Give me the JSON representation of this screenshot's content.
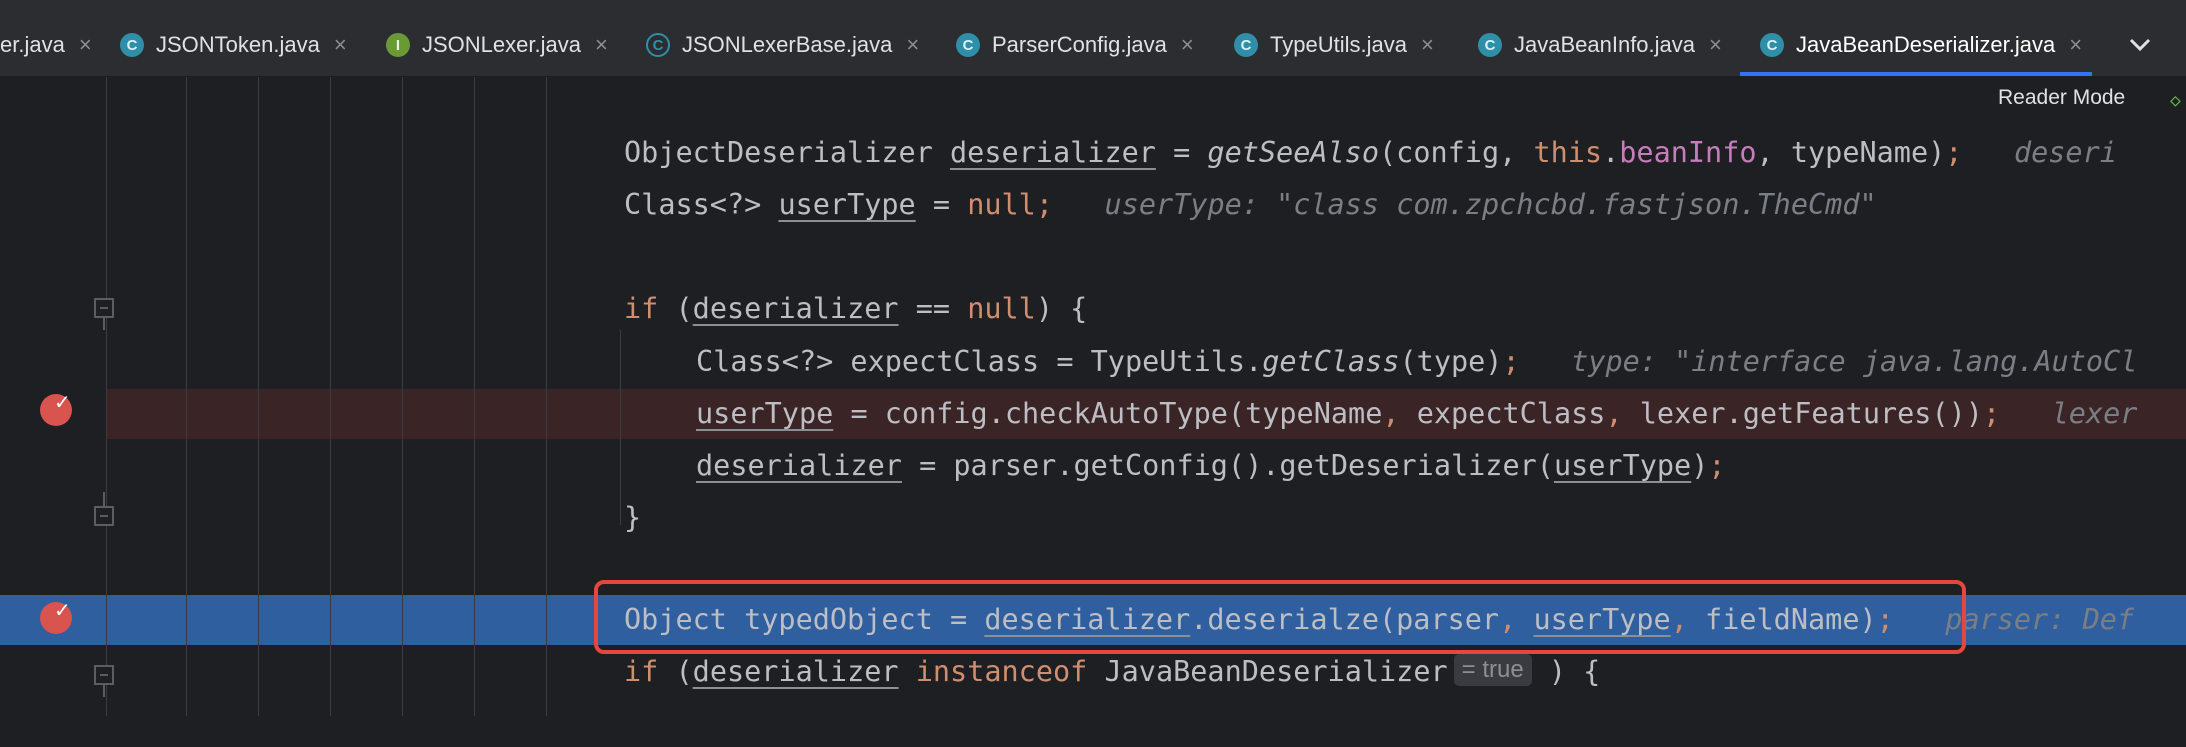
{
  "tabs": [
    {
      "label": "er.java",
      "icon": "class-icon",
      "kind": ""
    },
    {
      "label": "JSONToken.java",
      "icon": "class-icon",
      "kind": "c"
    },
    {
      "label": "JSONLexer.java",
      "icon": "interface-icon",
      "kind": "i"
    },
    {
      "label": "JSONLexerBase.java",
      "icon": "abstract-class-icon",
      "kind": "ac"
    },
    {
      "label": "ParserConfig.java",
      "icon": "class-icon",
      "kind": "c"
    },
    {
      "label": "TypeUtils.java",
      "icon": "class-icon",
      "kind": "c"
    },
    {
      "label": "JavaBeanInfo.java",
      "icon": "class-icon",
      "kind": "c"
    },
    {
      "label": "JavaBeanDeserializer.java",
      "icon": "class-icon",
      "kind": "c"
    }
  ],
  "tab_icon_letters": {
    "c": "C",
    "i": "I",
    "ac": "C"
  },
  "tab_close_glyph": "×",
  "reader_mode": "Reader Mode",
  "code": {
    "l1": {
      "a": "ObjectDeserializer ",
      "b": "deserializer",
      "c": " = ",
      "d": "getSeeAlso",
      "e": "(config, ",
      "f": "this",
      "g": ".",
      "h": "beanInfo",
      "i": ", typeName)",
      "j": ";",
      "hint": "deseri"
    },
    "l2": {
      "a": "Class<?> ",
      "b": "userType",
      "c": " = ",
      "d": "null",
      "e": ";",
      "hint": "userType: \"class com.zpchcbd.fastjson.TheCmd\""
    },
    "l3": {
      "a": "if",
      "b": " (",
      "c": "deserializer",
      "d": " == ",
      "e": "null",
      "f": ") {"
    },
    "l4": {
      "a": "Class<?> expectClass = TypeUtils.",
      "b": "getClass",
      "c": "(type)",
      "d": ";",
      "hint": "type: \"interface java.lang.AutoCl"
    },
    "l5": {
      "a": "userType",
      "b": " = config.checkAutoType(typeName",
      "c": ",",
      "d": " expectClass",
      "e": ",",
      "f": " lexer.getFeatures())",
      "g": ";",
      "hint": "lexer"
    },
    "l6": {
      "a": "deserializer",
      "b": " = parser.getConfig().getDeserializer(",
      "c": "userType",
      "d": ")",
      "e": ";"
    },
    "l7": {
      "a": "}"
    },
    "l8": {
      "a": "Object typedObject = ",
      "b": "deserializer",
      "c": ".deserialze(parser",
      "d": ",",
      "e": " ",
      "f": "userType",
      "g": ",",
      "h": " fieldName)",
      "i": ";",
      "hint": "parser: Def"
    },
    "l9": {
      "a": "if",
      "b": " (",
      "c": "deserializer",
      "d": " ",
      "e": "instanceof",
      "f": " JavaBeanDeserializer",
      "inlay": "= true",
      "g": " ) {"
    }
  },
  "colors": {
    "keyword": "#cf8e6d",
    "field": "#c77dbb",
    "hint": "#7a7e85",
    "highlight": "#2f5f9f",
    "breakpoint": "#d9534f",
    "annotation_box": "#e5463d",
    "active_tab_underline": "#3574f0"
  }
}
